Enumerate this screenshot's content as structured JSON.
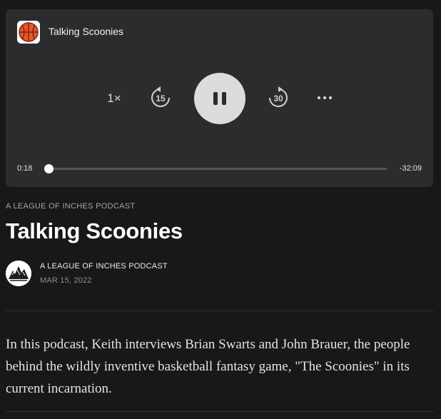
{
  "player": {
    "episode_title": "Talking Scoonies",
    "speed_label": "1×",
    "skip_back_seconds": "15",
    "skip_forward_seconds": "30",
    "elapsed": "0:18",
    "remaining": "-32:09",
    "progress_fraction": 0.0092,
    "state": "playing",
    "artwork_icon": "basketball-icon",
    "more_icon": "more-horizontal-icon"
  },
  "article": {
    "kicker": "A LEAGUE OF INCHES PODCAST",
    "title": "Talking Scoonies",
    "author": "A LEAGUE OF INCHES PODCAST",
    "date": "MAR 15, 2022",
    "body": "In this podcast, Keith interviews Brian Swarts and John Brauer, the people behind the wildly inventive basketball fantasy game, \"The Scoonies\" in its current incarnation."
  },
  "colors": {
    "background": "#18181a",
    "player_bg": "#2b2c2d",
    "play_button": "#dcdcdc",
    "basketball": "#e8562a"
  }
}
